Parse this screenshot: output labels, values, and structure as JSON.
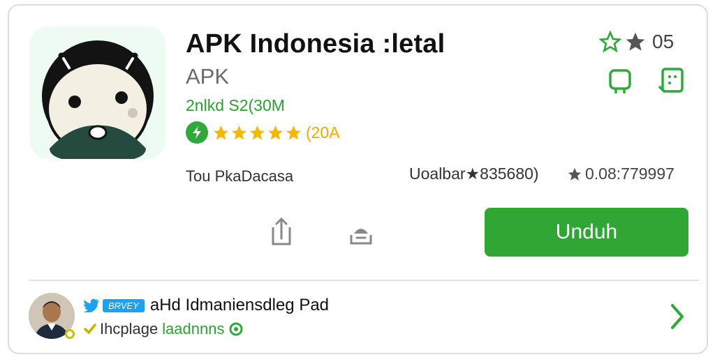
{
  "app": {
    "title": "APK Indonesia :letal",
    "subtitle": "APK",
    "size_info": "2nlkd S2(30M",
    "rating_count": "(20A",
    "star_count": 5,
    "developer": "Tou PkaDacasa"
  },
  "stats": {
    "left": "Uoalbar★835680)",
    "right": "0.08:779997"
  },
  "top_right": {
    "count": "05"
  },
  "actions": {
    "download_label": "Unduh"
  },
  "review": {
    "badge": "BRVEY",
    "title": "aHd Idmaniensdleg Pad",
    "user": "Ihcplage",
    "link": "laadnnns"
  },
  "colors": {
    "accent_green": "#30a735",
    "star_yellow": "#f5b800",
    "twitter_blue": "#1da1f2"
  },
  "icons": [
    "android-app-icon",
    "play-badge-icon",
    "star-icon",
    "rating-star-icon",
    "robot-icon",
    "list-icon",
    "share-icon",
    "save-icon",
    "twitter-icon",
    "verified-icon",
    "chevron-right-icon"
  ]
}
